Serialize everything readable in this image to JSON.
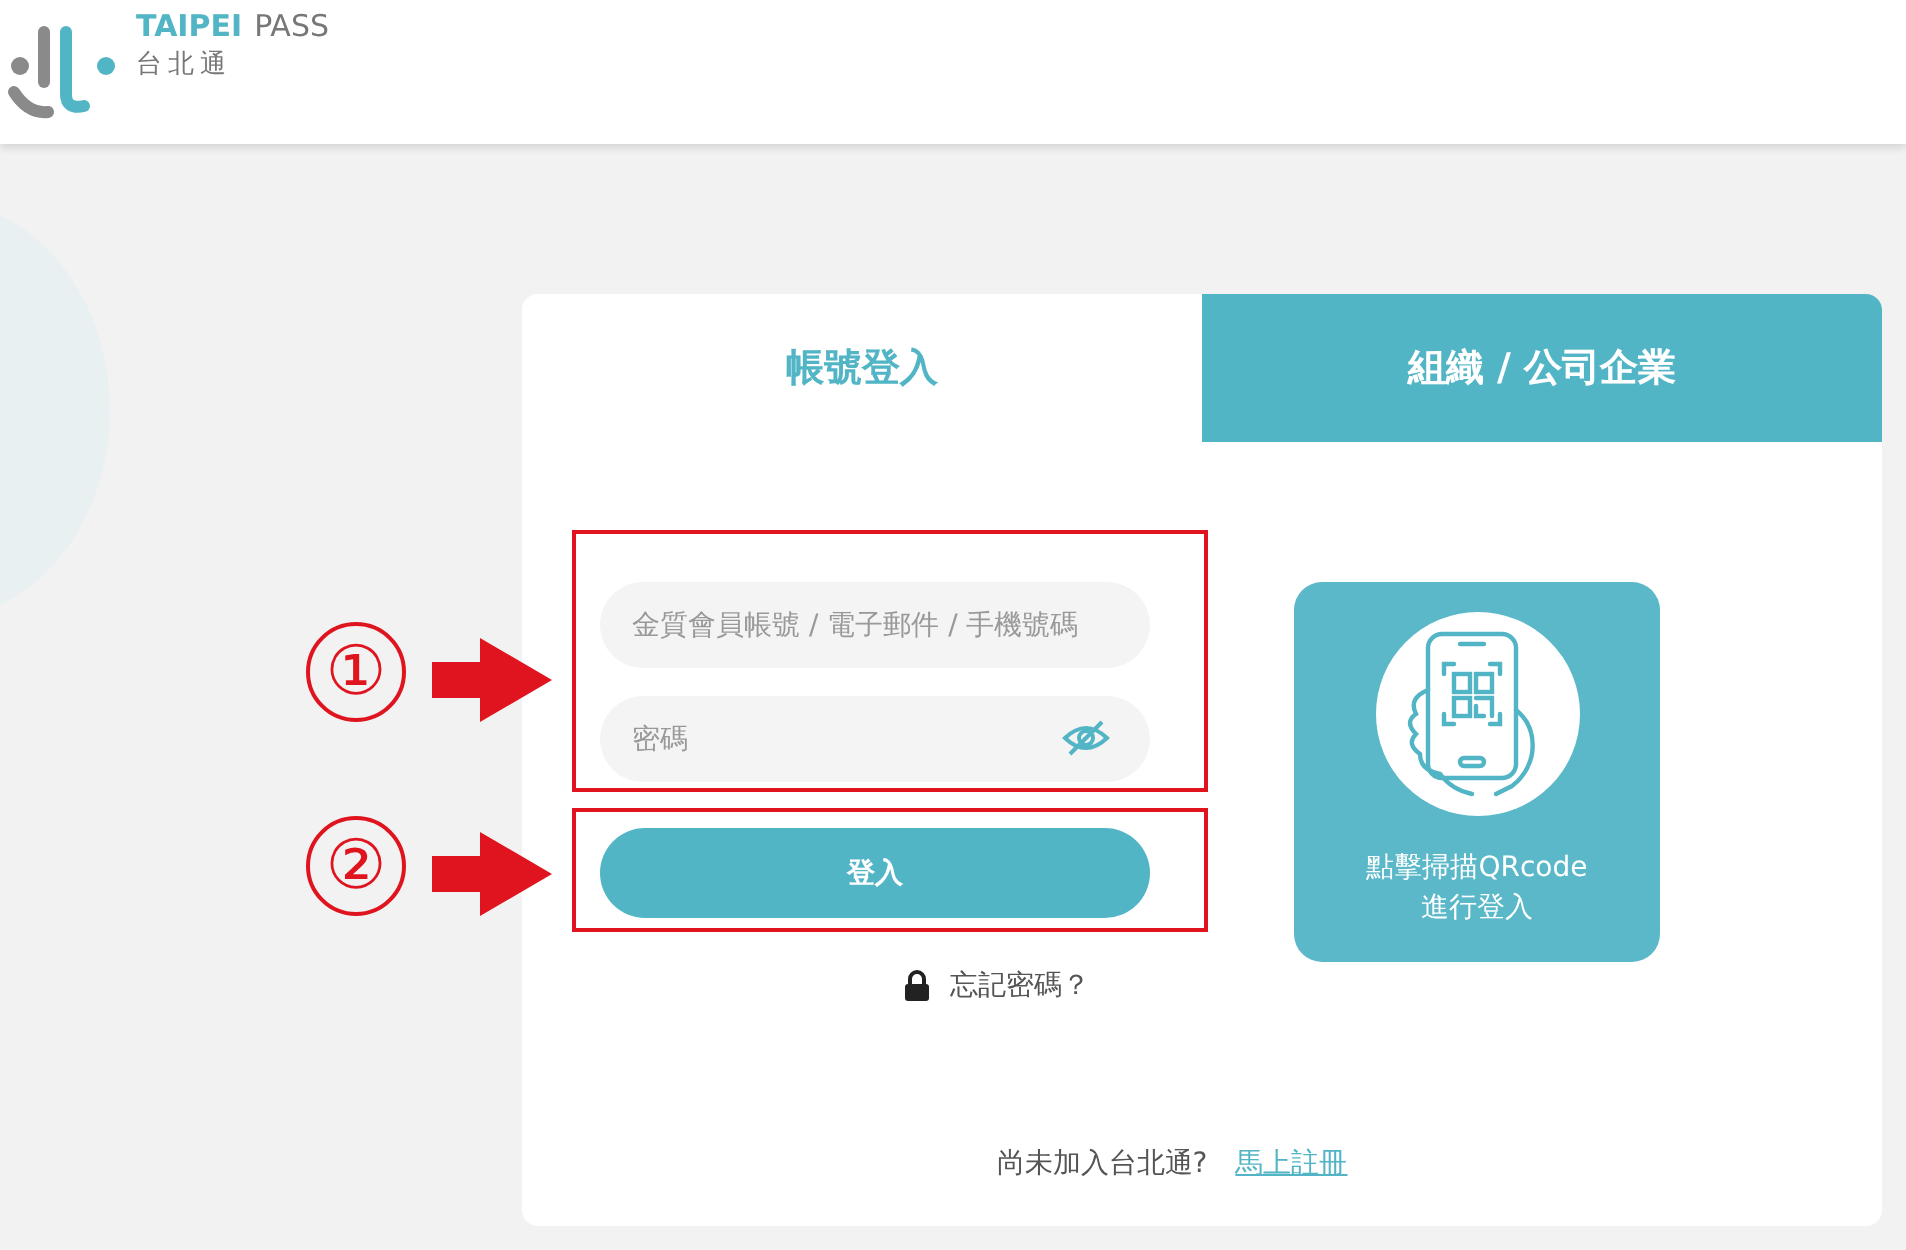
{
  "header": {
    "logo_accent": "TAIPEI",
    "logo_rest": "PASS",
    "logo_subtitle": "台北通"
  },
  "tabs": [
    {
      "label": "帳號登入",
      "selected": true
    },
    {
      "label": "組織 / 公司企業",
      "selected": false
    }
  ],
  "fields": [
    {
      "kind": "text",
      "placeholder": "金質會員帳號 / 電子郵件 / 手機號碼"
    },
    {
      "kind": "password",
      "placeholder": "密碼"
    }
  ],
  "login_button": "登入",
  "forgot_password": "忘記密碼？",
  "qr_login": {
    "line1": "點擊掃描QRcode",
    "line2": "進行登入"
  },
  "signup": {
    "prompt": "尚未加入台北通?",
    "link": "馬上註冊"
  },
  "annotations": [
    {
      "label": "①"
    },
    {
      "label": "②"
    }
  ]
}
